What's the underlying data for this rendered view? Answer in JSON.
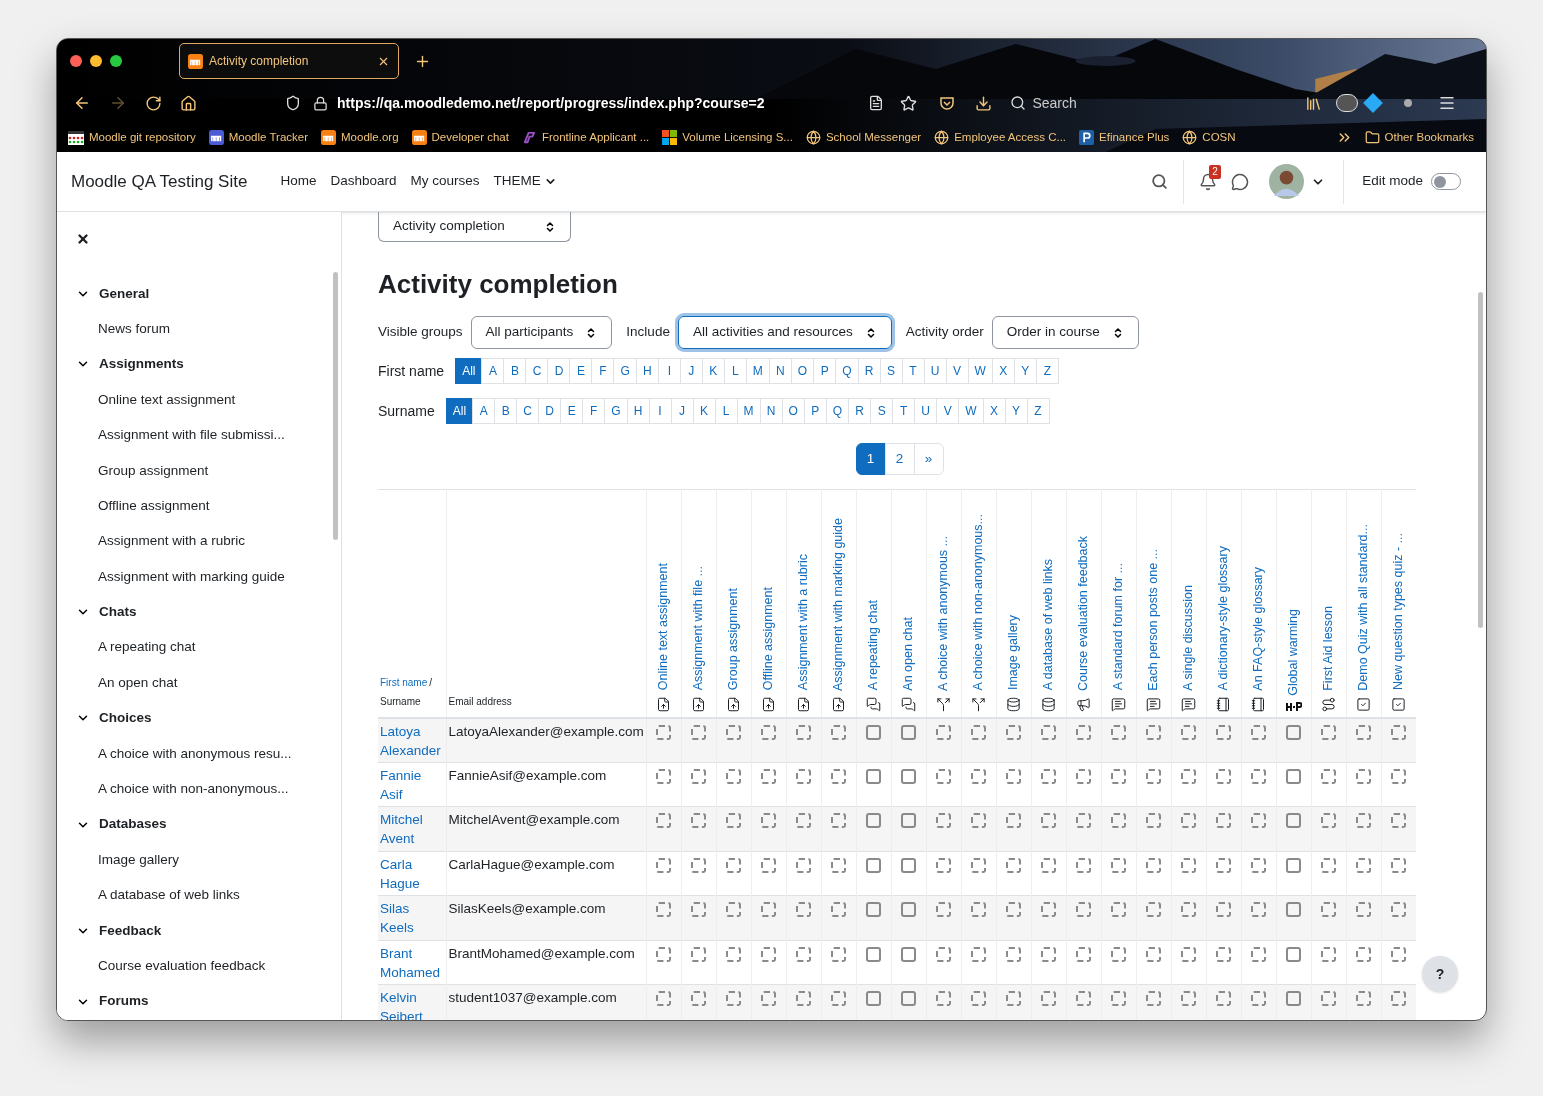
{
  "browser": {
    "tab": {
      "title": "Activity completion",
      "selected": true
    },
    "url": "https://qa.moodledemo.net/report/progress/index.php?course=2",
    "forward_disabled": true,
    "search": {
      "placeholder": "Search"
    },
    "bookmarks": [
      {
        "label": "Moodle git repository",
        "kind": "git"
      },
      {
        "label": "Moodle Tracker",
        "kind": "moodle-blue"
      },
      {
        "label": "Moodle.org",
        "kind": "moodle"
      },
      {
        "label": "Developer chat",
        "kind": "moodle"
      },
      {
        "label": "Frontline Applicant ...",
        "kind": "frontline"
      },
      {
        "label": "Volume Licensing S...",
        "kind": "windows"
      },
      {
        "label": "School Messenger",
        "kind": "globe"
      },
      {
        "label": "Employee Access C...",
        "kind": "globe"
      },
      {
        "label": "Efinance Plus",
        "kind": "pay"
      },
      {
        "label": "COSN",
        "kind": "globe"
      }
    ],
    "other_bookmarks": "Other Bookmarks"
  },
  "navbar": {
    "site_name": "Moodle QA Testing Site",
    "links": [
      {
        "label": "Home",
        "dropdown": false
      },
      {
        "label": "Dashboard",
        "dropdown": false
      },
      {
        "label": "My courses",
        "dropdown": false
      },
      {
        "label": "THEME",
        "dropdown": true
      }
    ],
    "notification_count": "2",
    "edit_mode": {
      "label": "Edit mode",
      "on": false
    }
  },
  "sidebar": {
    "sections": [
      {
        "label": "General",
        "expanded": true,
        "children": [
          {
            "label": "News forum"
          }
        ]
      },
      {
        "label": "Assignments",
        "expanded": true,
        "children": [
          {
            "label": "Online text assignment"
          },
          {
            "label": "Assignment with file submissi..."
          },
          {
            "label": "Group assignment"
          },
          {
            "label": "Offline assignment"
          },
          {
            "label": "Assignment with a rubric"
          },
          {
            "label": "Assignment with marking guide"
          }
        ]
      },
      {
        "label": "Chats",
        "expanded": true,
        "children": [
          {
            "label": "A repeating chat"
          },
          {
            "label": "An open chat"
          }
        ]
      },
      {
        "label": "Choices",
        "expanded": true,
        "children": [
          {
            "label": "A choice with anonymous resu..."
          },
          {
            "label": "A choice with non-anonymous..."
          }
        ]
      },
      {
        "label": "Databases",
        "expanded": true,
        "children": [
          {
            "label": "Image gallery"
          },
          {
            "label": "A database of web links"
          }
        ]
      },
      {
        "label": "Feedback",
        "expanded": true,
        "children": [
          {
            "label": "Course evaluation feedback"
          }
        ]
      },
      {
        "label": "Forums",
        "expanded": true
      }
    ]
  },
  "report_select": "Activity completion",
  "heading": "Activity completion",
  "filters": [
    {
      "label": "Visible groups",
      "value": "All participants",
      "focused": false
    },
    {
      "label": "Include",
      "value": "All activities and resources",
      "focused": true
    },
    {
      "label": "Activity order",
      "value": "Order in course",
      "focused": false
    }
  ],
  "first_name_filter": {
    "label": "First name",
    "letters": [
      {
        "label": "All",
        "selected": true
      },
      {
        "label": "A",
        "selected": false
      },
      {
        "label": "B",
        "selected": false
      },
      {
        "label": "C",
        "selected": false
      },
      {
        "label": "D",
        "selected": false
      },
      {
        "label": "E",
        "selected": false
      },
      {
        "label": "F",
        "selected": false
      },
      {
        "label": "G",
        "selected": false
      },
      {
        "label": "H",
        "selected": false
      },
      {
        "label": "I",
        "selected": false
      },
      {
        "label": "J",
        "selected": false
      },
      {
        "label": "K",
        "selected": false
      },
      {
        "label": "L",
        "selected": false
      },
      {
        "label": "M",
        "selected": false
      },
      {
        "label": "N",
        "selected": false
      },
      {
        "label": "O",
        "selected": false
      },
      {
        "label": "P",
        "selected": false
      },
      {
        "label": "Q",
        "selected": false
      },
      {
        "label": "R",
        "selected": false
      },
      {
        "label": "S",
        "selected": false
      },
      {
        "label": "T",
        "selected": false
      },
      {
        "label": "U",
        "selected": false
      },
      {
        "label": "V",
        "selected": false
      },
      {
        "label": "W",
        "selected": false
      },
      {
        "label": "X",
        "selected": false
      },
      {
        "label": "Y",
        "selected": false
      },
      {
        "label": "Z",
        "selected": false
      }
    ]
  },
  "surname_filter": {
    "label": "Surname",
    "letters": [
      {
        "label": "All",
        "selected": true
      },
      {
        "label": "A",
        "selected": false
      },
      {
        "label": "B",
        "selected": false
      },
      {
        "label": "C",
        "selected": false
      },
      {
        "label": "D",
        "selected": false
      },
      {
        "label": "E",
        "selected": false
      },
      {
        "label": "F",
        "selected": false
      },
      {
        "label": "G",
        "selected": false
      },
      {
        "label": "H",
        "selected": false
      },
      {
        "label": "I",
        "selected": false
      },
      {
        "label": "J",
        "selected": false
      },
      {
        "label": "K",
        "selected": false
      },
      {
        "label": "L",
        "selected": false
      },
      {
        "label": "M",
        "selected": false
      },
      {
        "label": "N",
        "selected": false
      },
      {
        "label": "O",
        "selected": false
      },
      {
        "label": "P",
        "selected": false
      },
      {
        "label": "Q",
        "selected": false
      },
      {
        "label": "R",
        "selected": false
      },
      {
        "label": "S",
        "selected": false
      },
      {
        "label": "T",
        "selected": false
      },
      {
        "label": "U",
        "selected": false
      },
      {
        "label": "V",
        "selected": false
      },
      {
        "label": "W",
        "selected": false
      },
      {
        "label": "X",
        "selected": false
      },
      {
        "label": "Y",
        "selected": false
      },
      {
        "label": "Z",
        "selected": false
      }
    ]
  },
  "pagination": [
    {
      "label": "1",
      "selected": true
    },
    {
      "label": "2",
      "selected": false
    },
    {
      "label": "»",
      "selected": false
    }
  ],
  "table": {
    "name_header": {
      "first": "First name",
      "separator": "/",
      "second": "Surname"
    },
    "email_header": "Email address",
    "activities": [
      {
        "name": "Online text assignment",
        "kind": "assign",
        "manual": false
      },
      {
        "name": "Assignment with file ...",
        "kind": "assign",
        "manual": false
      },
      {
        "name": "Group assignment",
        "kind": "assign",
        "manual": false
      },
      {
        "name": "Offline assignment",
        "kind": "assign",
        "manual": false
      },
      {
        "name": "Assignment with a rubric",
        "kind": "assign",
        "manual": false
      },
      {
        "name": "Assignment with marking guide",
        "kind": "assign",
        "manual": false
      },
      {
        "name": "A repeating chat",
        "kind": "chat",
        "manual": true
      },
      {
        "name": "An open chat",
        "kind": "chat",
        "manual": true
      },
      {
        "name": "A choice with anonymous ...",
        "kind": "choice",
        "manual": false
      },
      {
        "name": "A choice with non-anonymous...",
        "kind": "choice",
        "manual": false
      },
      {
        "name": "Image gallery",
        "kind": "data",
        "manual": false
      },
      {
        "name": "A database of web links",
        "kind": "data",
        "manual": false
      },
      {
        "name": "Course evaluation feedback",
        "kind": "feedback",
        "manual": false
      },
      {
        "name": "A standard forum for ...",
        "kind": "forum",
        "manual": false
      },
      {
        "name": "Each person posts one ...",
        "kind": "forum",
        "manual": false
      },
      {
        "name": "A single discussion",
        "kind": "forum",
        "manual": false
      },
      {
        "name": "A dictionary-style glossary",
        "kind": "glossary",
        "manual": false
      },
      {
        "name": "An FAQ-style glossary",
        "kind": "glossary",
        "manual": false
      },
      {
        "name": "Global warming",
        "kind": "h5p",
        "manual": true
      },
      {
        "name": "First Aid lesson",
        "kind": "lesson",
        "manual": false
      },
      {
        "name": "Demo Quiz with all standard...",
        "kind": "quiz",
        "manual": false
      },
      {
        "name": "New question types quiz - ...",
        "kind": "quiz",
        "manual": false
      }
    ],
    "rows": [
      {
        "first_name": "Latoya",
        "surname": "Alexander",
        "email": "LatoyaAlexander@example.com",
        "completed": [
          false,
          false,
          false,
          false,
          false,
          false,
          false,
          false,
          false,
          false,
          false,
          false,
          false,
          false,
          false,
          false,
          false,
          false,
          false,
          false,
          false,
          false
        ]
      },
      {
        "first_name": "Fannie",
        "surname": "Asif",
        "email": "FannieAsif@example.com",
        "completed": [
          false,
          false,
          false,
          false,
          false,
          false,
          false,
          false,
          false,
          false,
          false,
          false,
          false,
          false,
          false,
          false,
          false,
          false,
          false,
          false,
          false,
          false
        ]
      },
      {
        "first_name": "Mitchel",
        "surname": "Avent",
        "email": "MitchelAvent@example.com",
        "completed": [
          false,
          false,
          false,
          false,
          false,
          false,
          false,
          false,
          false,
          false,
          false,
          false,
          false,
          false,
          false,
          false,
          false,
          false,
          false,
          false,
          false,
          false
        ]
      },
      {
        "first_name": "Carla",
        "surname": "Hague",
        "email": "CarlaHague@example.com",
        "completed": [
          false,
          false,
          false,
          false,
          false,
          false,
          false,
          false,
          false,
          false,
          false,
          false,
          false,
          false,
          false,
          false,
          false,
          false,
          false,
          false,
          false,
          false
        ]
      },
      {
        "first_name": "Silas",
        "surname": "Keels",
        "email": "SilasKeels@example.com",
        "completed": [
          false,
          false,
          false,
          false,
          false,
          false,
          false,
          false,
          false,
          false,
          false,
          false,
          false,
          false,
          false,
          false,
          false,
          false,
          false,
          false,
          false,
          false
        ]
      },
      {
        "first_name": "Brant",
        "surname": "Mohamed",
        "email": "BrantMohamed@example.com",
        "completed": [
          false,
          false,
          false,
          false,
          false,
          false,
          false,
          false,
          false,
          false,
          false,
          false,
          false,
          false,
          false,
          false,
          false,
          false,
          false,
          false,
          false,
          false
        ]
      },
      {
        "first_name": "Kelvin",
        "surname": "Seibert",
        "email": "student1037@example.com",
        "completed": [
          false,
          false,
          false,
          false,
          false,
          false,
          false,
          false,
          false,
          false,
          false,
          false,
          false,
          false,
          false,
          false,
          false,
          false,
          false,
          false,
          false,
          false
        ]
      }
    ]
  },
  "help_button": "?"
}
